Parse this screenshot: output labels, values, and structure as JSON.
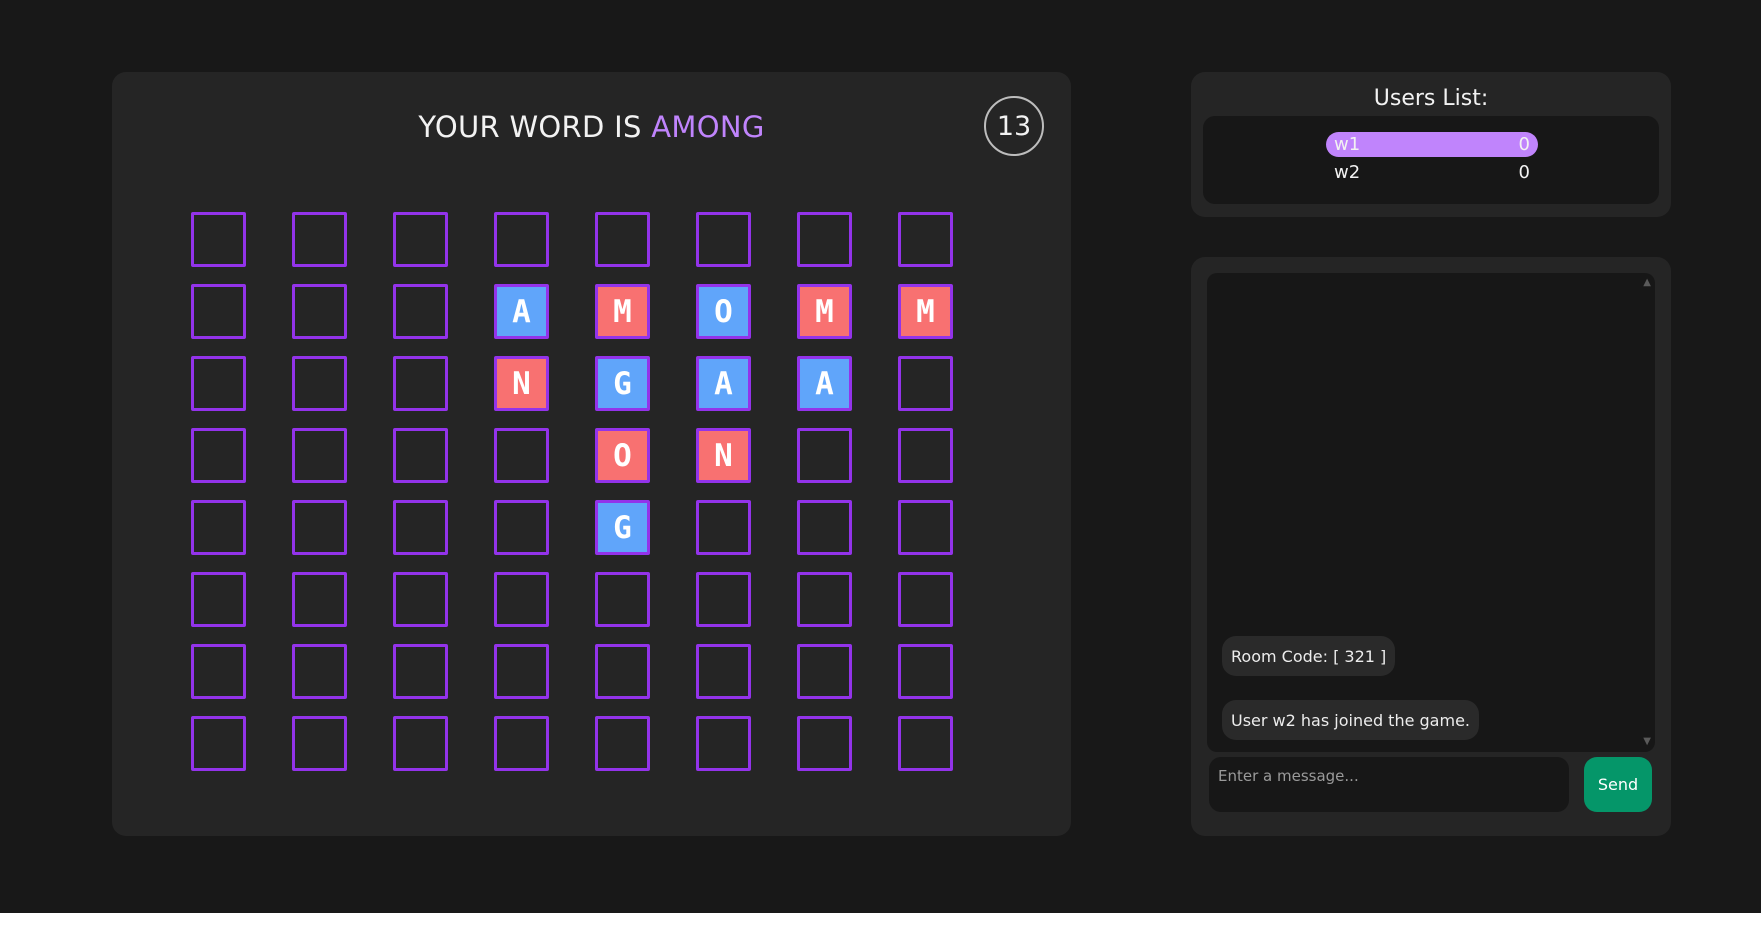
{
  "game": {
    "title_prefix": "YOUR WORD IS",
    "word": "AMONG",
    "timer": "13",
    "grid": [
      [
        {
          "letter": "",
          "color": ""
        },
        {
          "letter": "",
          "color": ""
        },
        {
          "letter": "",
          "color": ""
        },
        {
          "letter": "",
          "color": ""
        },
        {
          "letter": "",
          "color": ""
        },
        {
          "letter": "",
          "color": ""
        },
        {
          "letter": "",
          "color": ""
        },
        {
          "letter": "",
          "color": ""
        }
      ],
      [
        {
          "letter": "",
          "color": ""
        },
        {
          "letter": "",
          "color": ""
        },
        {
          "letter": "",
          "color": ""
        },
        {
          "letter": "A",
          "color": "blue"
        },
        {
          "letter": "M",
          "color": "red"
        },
        {
          "letter": "O",
          "color": "blue"
        },
        {
          "letter": "M",
          "color": "red"
        },
        {
          "letter": "M",
          "color": "red"
        }
      ],
      [
        {
          "letter": "",
          "color": ""
        },
        {
          "letter": "",
          "color": ""
        },
        {
          "letter": "",
          "color": ""
        },
        {
          "letter": "N",
          "color": "red"
        },
        {
          "letter": "G",
          "color": "blue"
        },
        {
          "letter": "A",
          "color": "blue"
        },
        {
          "letter": "A",
          "color": "blue"
        },
        {
          "letter": "",
          "color": ""
        }
      ],
      [
        {
          "letter": "",
          "color": ""
        },
        {
          "letter": "",
          "color": ""
        },
        {
          "letter": "",
          "color": ""
        },
        {
          "letter": "",
          "color": ""
        },
        {
          "letter": "O",
          "color": "red"
        },
        {
          "letter": "N",
          "color": "red"
        },
        {
          "letter": "",
          "color": ""
        },
        {
          "letter": "",
          "color": ""
        }
      ],
      [
        {
          "letter": "",
          "color": ""
        },
        {
          "letter": "",
          "color": ""
        },
        {
          "letter": "",
          "color": ""
        },
        {
          "letter": "",
          "color": ""
        },
        {
          "letter": "G",
          "color": "blue"
        },
        {
          "letter": "",
          "color": ""
        },
        {
          "letter": "",
          "color": ""
        },
        {
          "letter": "",
          "color": ""
        }
      ],
      [
        {
          "letter": "",
          "color": ""
        },
        {
          "letter": "",
          "color": ""
        },
        {
          "letter": "",
          "color": ""
        },
        {
          "letter": "",
          "color": ""
        },
        {
          "letter": "",
          "color": ""
        },
        {
          "letter": "",
          "color": ""
        },
        {
          "letter": "",
          "color": ""
        },
        {
          "letter": "",
          "color": ""
        }
      ],
      [
        {
          "letter": "",
          "color": ""
        },
        {
          "letter": "",
          "color": ""
        },
        {
          "letter": "",
          "color": ""
        },
        {
          "letter": "",
          "color": ""
        },
        {
          "letter": "",
          "color": ""
        },
        {
          "letter": "",
          "color": ""
        },
        {
          "letter": "",
          "color": ""
        },
        {
          "letter": "",
          "color": ""
        }
      ],
      [
        {
          "letter": "",
          "color": ""
        },
        {
          "letter": "",
          "color": ""
        },
        {
          "letter": "",
          "color": ""
        },
        {
          "letter": "",
          "color": ""
        },
        {
          "letter": "",
          "color": ""
        },
        {
          "letter": "",
          "color": ""
        },
        {
          "letter": "",
          "color": ""
        },
        {
          "letter": "",
          "color": ""
        }
      ]
    ]
  },
  "users": {
    "title": "Users List:",
    "list": [
      {
        "name": "w1",
        "score": "0",
        "active": true
      },
      {
        "name": "w2",
        "score": "0",
        "active": false
      }
    ]
  },
  "chat": {
    "messages": [
      {
        "text": "Room Code: [ 321 ]"
      },
      {
        "text": "User w2 has joined the game."
      }
    ],
    "input_placeholder": "Enter a message...",
    "input_value": "",
    "send_label": "Send"
  },
  "colors": {
    "accent_purple": "#c084fc",
    "cell_border": "#9333ea",
    "tile_blue": "#60a5fa",
    "tile_red": "#f87171",
    "send_green": "#059669"
  },
  "icons": {
    "scroll_up": "chevron-up-icon",
    "scroll_down": "chevron-down-icon"
  }
}
